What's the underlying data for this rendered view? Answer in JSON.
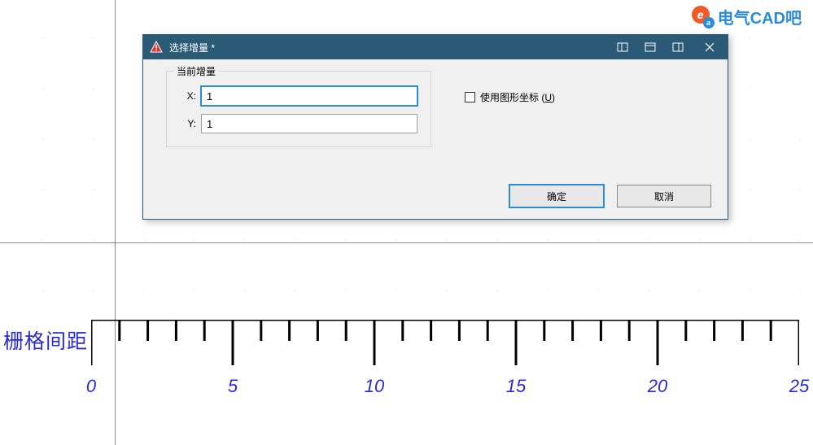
{
  "watermark": {
    "bigLetter": "e",
    "smallLetter": "a",
    "text": "电气CAD吧"
  },
  "dialog": {
    "title": "选择增量 *",
    "groupLabel": "当前增量",
    "xLabel": "X:",
    "xValue": "1",
    "yLabel": "Y:",
    "yValue": "1",
    "checkboxLabel": "使用图形坐标",
    "checkboxMnemonic": "U",
    "okLabel": "确定",
    "cancelLabel": "取消"
  },
  "rulerLabel": "栅格间距",
  "ruler": {
    "min": 0,
    "max": 25,
    "majorStep": 5,
    "minorStep": 1,
    "ticks": [
      "0",
      "5",
      "10",
      "15",
      "20",
      "25"
    ]
  }
}
